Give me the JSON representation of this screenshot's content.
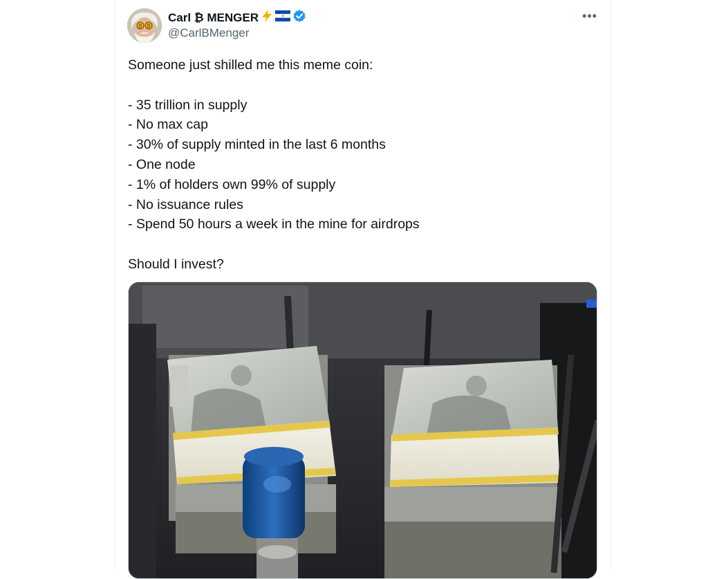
{
  "author": {
    "display_name": "Carl ₿ MENGER",
    "handle": "@CarlBMenger",
    "badges": [
      "lightning-emoji",
      "el-salvador-flag",
      "verified-badge"
    ]
  },
  "post": {
    "lines": [
      "Someone just shilled me this meme coin:",
      "",
      "- 35 trillion in supply",
      "- No max cap",
      "- 30% of supply minted in the last 6 months",
      "- One node",
      "- 1% of holders own 99% of supply",
      "- No issuance rules",
      "- Spend 50 hours a week in the mine for airdrops",
      "",
      "Should I invest?"
    ],
    "media": {
      "kind": "image",
      "subject": "stacks of banded $100 bills on a money counting machine"
    }
  },
  "colors": {
    "text": "#0f1419",
    "secondary": "#536471",
    "verified": "#1d9bf0",
    "divider": "#eff3f4"
  },
  "icons": [
    "more-options-icon"
  ]
}
